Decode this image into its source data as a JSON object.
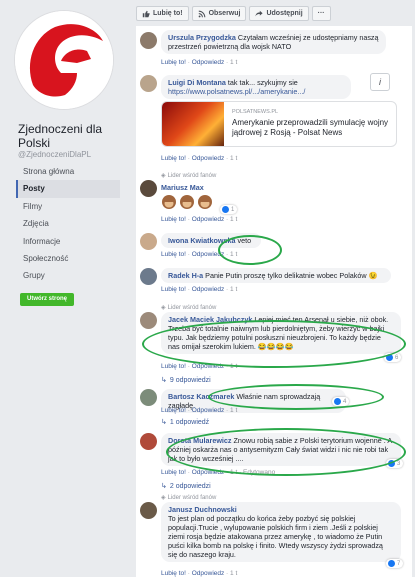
{
  "page": {
    "name": "Zjednoczeni dla Polski",
    "handle": "@ZjednoczeniDlaPL",
    "nav": [
      "Strona główna",
      "Posty",
      "Filmy",
      "Zdjęcia",
      "Informacje",
      "Społeczność",
      "Grupy"
    ],
    "active_nav": 1,
    "create_button": "Utwórz stronę"
  },
  "topbar": {
    "like": "Lubię to!",
    "follow": "Obserwuj",
    "share": "Udostępnij",
    "more": "···"
  },
  "colors": {
    "link": "#385898",
    "green_circle": "#2aa84a",
    "brand_red": "#d8141e"
  },
  "common": {
    "like": "Lubię to!",
    "reply": "Odpowiedz",
    "sep": " · ",
    "fan_badge": "Lider wśród fanów",
    "edited": "Edytowano"
  },
  "comments": [
    {
      "author": "Urszula Przygodzka",
      "text": "Czytałam wcześniej ze udostępniamy naszą przestrzeń powietrzną dla wojsk NATO",
      "time": "1 t"
    },
    {
      "author": "Luigi Di Montana",
      "text": "tak tak... szykujmy sie",
      "link": "https://www.polsatnews.pl/.../amerykanie.../",
      "preview_source": "POLSATNEWS.PL",
      "preview_title": "Amerykanie przeprowadzili symulację wojny jądrowej z Rosją - Polsat News",
      "time": "1 t"
    },
    {
      "author": "Mariusz Max",
      "text": "",
      "time": "1 t",
      "reactions": "1"
    },
    {
      "author": "Iwona Kwiatkowska",
      "text": "veto",
      "time": "1 t"
    },
    {
      "author": "Radek H-a",
      "text": "Panie Putin proszę tylko delikatnie wobec Polaków 😉",
      "time": "1 t"
    },
    {
      "author": "Jacek Maciek Jakubczyk",
      "text": "Lepiej mieć ten Arsenał u siebie, niż obok. Trzeba być totalnie naiwnym lub pierdolniętym, żeby wierzyć w bajki typu. Jak będziemy potulni posłuszni nieuzbrojeni. To każdy będzie nas omijał szerokim lukiem. 😂😂😂😂",
      "time": "1 t",
      "reactions": "6",
      "replies": "9 odpowiedzi"
    },
    {
      "author": "Bartosz Kaczmarek",
      "text": "Właśnie nam sprowadzają zagładę.",
      "time": "1 t",
      "reactions": "4",
      "replies": "1 odpowiedź"
    },
    {
      "author": "Dorota Mularewicz",
      "text": "Znowu robią sabie z Polski terytorium wojenne . A później oskarża nas o antysemityzm Cały świat widzi i nic nie robi tak jak to było wcześniej ....",
      "time": "1 t",
      "reactions": "3",
      "replies": "2 odpowiedzi"
    },
    {
      "author": "Janusz Duchnowski",
      "text": "To jest plan od początku do końca żeby pozbyć się polskiej populacji.Trucie , wylupowanie polskich firm i ziem .Jeśli z polskiej ziemi rosja będzie atakowana przez amerykę , to wiadomo że Putin puści kilka bomb na polskę i finito. Wtedy wszyscy żydzi sprowadzą się do naszego kraju.",
      "time": "1 t",
      "reactions": "7"
    }
  ]
}
